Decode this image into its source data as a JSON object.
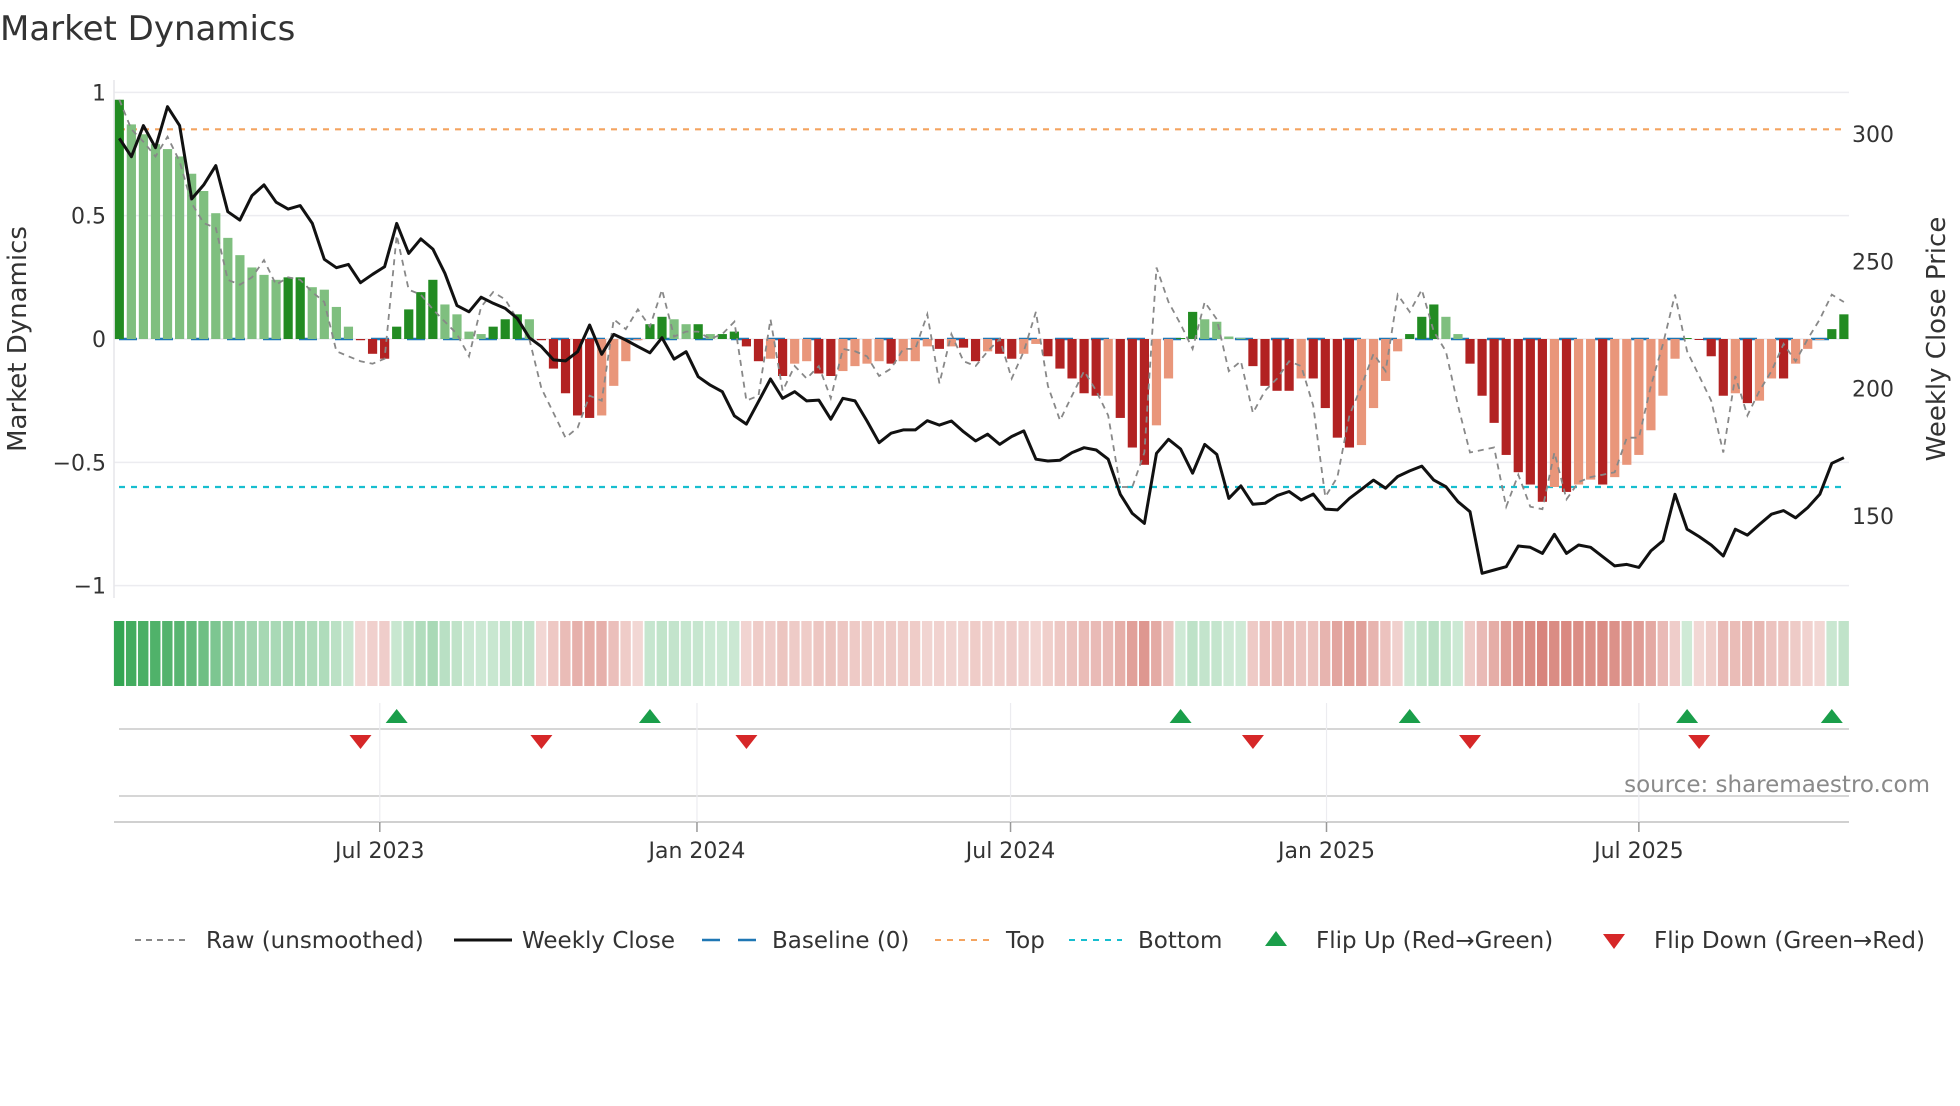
{
  "chart_data": {
    "type": "bar",
    "title": "Market Dynamics",
    "ylabel": "Market Dynamics",
    "ylabel_right": "Weekly Close Price",
    "xlabel": "",
    "ylim": [
      -1.05,
      1.05
    ],
    "ylim_right": [
      117.8,
      321.2
    ],
    "yticks": [
      {
        "v": 1,
        "label": "1"
      },
      {
        "v": 0.5,
        "label": "0.5"
      },
      {
        "v": 0,
        "label": "0"
      },
      {
        "v": -0.5,
        "label": "−0.5"
      },
      {
        "v": -1,
        "label": "−1"
      }
    ],
    "yticks_right": [
      {
        "v": 300,
        "label": "300"
      },
      {
        "v": 250,
        "label": "250"
      },
      {
        "v": 200,
        "label": "200"
      },
      {
        "v": 150,
        "label": "150"
      }
    ],
    "x_unit": "week index",
    "xticks": [
      {
        "week": 21.6,
        "label": "Jul 2023"
      },
      {
        "week": 47.9,
        "label": "Jan 2024"
      },
      {
        "week": 73.9,
        "label": "Jul 2024"
      },
      {
        "week": 100.1,
        "label": "Jan 2025"
      },
      {
        "week": 126.0,
        "label": "Jul 2025"
      }
    ],
    "grid": true,
    "legend_position": "bottom",
    "top_level": 0.85,
    "bottom_level": -0.6,
    "baseline": 0,
    "values": [
      0.97,
      0.87,
      0.83,
      0.79,
      0.77,
      0.74,
      0.67,
      0.6,
      0.51,
      0.41,
      0.34,
      0.29,
      0.26,
      0.24,
      0.25,
      0.25,
      0.21,
      0.2,
      0.13,
      0.05,
      -0.005,
      -0.06,
      -0.08,
      0.05,
      0.12,
      0.19,
      0.24,
      0.14,
      0.1,
      0.03,
      0.02,
      0.05,
      0.08,
      0.1,
      0.08,
      -0.005,
      -0.12,
      -0.22,
      -0.31,
      -0.32,
      -0.31,
      -0.19,
      -0.09,
      -0.005,
      0.06,
      0.09,
      0.08,
      0.06,
      0.06,
      0.02,
      0.02,
      0.03,
      -0.03,
      -0.09,
      -0.08,
      -0.15,
      -0.1,
      -0.09,
      -0.14,
      -0.15,
      -0.13,
      -0.11,
      -0.1,
      -0.09,
      -0.1,
      -0.09,
      -0.09,
      -0.03,
      -0.04,
      -0.03,
      -0.035,
      -0.09,
      -0.05,
      -0.06,
      -0.08,
      -0.06,
      -0.02,
      -0.07,
      -0.12,
      -0.16,
      -0.22,
      -0.23,
      -0.23,
      -0.32,
      -0.44,
      -0.51,
      -0.35,
      -0.16,
      0.004,
      0.11,
      0.08,
      0.07,
      0.01,
      0.004,
      -0.11,
      -0.19,
      -0.21,
      -0.21,
      -0.16,
      -0.16,
      -0.28,
      -0.4,
      -0.44,
      -0.43,
      -0.28,
      -0.17,
      -0.05,
      0.02,
      0.09,
      0.14,
      0.09,
      0.02,
      -0.1,
      -0.23,
      -0.34,
      -0.47,
      -0.54,
      -0.59,
      -0.66,
      -0.6,
      -0.62,
      -0.59,
      -0.57,
      -0.59,
      -0.56,
      -0.51,
      -0.47,
      -0.37,
      -0.23,
      -0.08,
      0.004,
      -0.004,
      -0.07,
      -0.23,
      -0.22,
      -0.26,
      -0.25,
      -0.16,
      -0.16,
      -0.1,
      -0.04,
      -0.004,
      0.04,
      0.1
    ],
    "shades": "dlllllllllllllddlllldddddddlllldddldddddllllddlldlddddldlldd lllldllldlddlddllddd ddldddlldd llllddddld dddllllddd lldddddddl dlldllllll ddddldlldl lldd",
    "raw": [
      0.97,
      0.85,
      0.8,
      0.74,
      0.82,
      0.72,
      0.55,
      0.47,
      0.45,
      0.24,
      0.22,
      0.25,
      0.32,
      0.22,
      0.25,
      0.24,
      0.19,
      0.15,
      -0.05,
      -0.07,
      -0.09,
      -0.1,
      -0.08,
      0.42,
      0.2,
      0.18,
      0.12,
      0.07,
      0.02,
      -0.07,
      0.13,
      0.19,
      0.16,
      0.08,
      0.0,
      -0.2,
      -0.3,
      -0.4,
      -0.36,
      -0.23,
      -0.25,
      0.08,
      0.04,
      0.12,
      0.05,
      0.2,
      0.01,
      0.03,
      0.03,
      0.0,
      0.02,
      0.07,
      -0.25,
      -0.23,
      0.08,
      -0.21,
      -0.11,
      -0.16,
      -0.11,
      -0.24,
      -0.04,
      -0.05,
      -0.07,
      -0.15,
      -0.12,
      -0.04,
      -0.04,
      0.1,
      -0.18,
      0.02,
      -0.09,
      -0.11,
      -0.05,
      0.0,
      -0.16,
      -0.05,
      0.11,
      -0.19,
      -0.33,
      -0.23,
      -0.13,
      -0.21,
      -0.31,
      -0.6,
      -0.6,
      -0.46,
      0.29,
      0.15,
      0.06,
      -0.04,
      0.15,
      0.08,
      -0.13,
      -0.09,
      -0.3,
      -0.21,
      -0.16,
      -0.09,
      -0.11,
      -0.27,
      -0.64,
      -0.56,
      -0.31,
      -0.19,
      -0.06,
      -0.13,
      0.18,
      0.11,
      0.2,
      0.03,
      -0.05,
      -0.27,
      -0.46,
      -0.45,
      -0.44,
      -0.68,
      -0.55,
      -0.68,
      -0.69,
      -0.46,
      -0.65,
      -0.58,
      -0.56,
      -0.55,
      -0.54,
      -0.4,
      -0.4,
      -0.19,
      -0.02,
      0.18,
      -0.05,
      -0.15,
      -0.25,
      -0.46,
      -0.15,
      -0.31,
      -0.21,
      -0.13,
      -0.02,
      -0.09,
      0.0,
      0.08,
      0.18,
      0.15
    ],
    "weekly_close": [
      298.3,
      291.1,
      303.3,
      294.6,
      310.7,
      303.3,
      274.5,
      280.0,
      287.6,
      269.5,
      266.2,
      275.8,
      280.0,
      273.2,
      270.5,
      271.9,
      264.9,
      250.8,
      247.5,
      248.8,
      241.6,
      244.9,
      247.9,
      264.9,
      253.1,
      258.8,
      254.8,
      245.3,
      232.6,
      230.2,
      235.9,
      233.5,
      231.5,
      227.6,
      220.0,
      216.5,
      211.3,
      210.9,
      214.5,
      225.0,
      213.5,
      221.3,
      219.1,
      216.5,
      214.1,
      220.0,
      211.6,
      214.5,
      204.7,
      201.4,
      198.8,
      189.3,
      186.1,
      194.9,
      203.8,
      196.2,
      198.8,
      195.2,
      195.5,
      188.0,
      196.2,
      195.2,
      187.3,
      178.8,
      182.5,
      183.8,
      183.8,
      187.4,
      185.7,
      187.3,
      183.1,
      179.5,
      182.1,
      178.1,
      181.2,
      183.4,
      172.3,
      171.6,
      171.9,
      174.9,
      176.8,
      175.9,
      172.3,
      158.5,
      151.0,
      147.1,
      174.6,
      180.1,
      176.3,
      166.8,
      178.1,
      174.2,
      156.9,
      161.8,
      154.6,
      155.0,
      158.0,
      159.6,
      156.3,
      158.6,
      152.7,
      152.4,
      156.9,
      160.5,
      164.1,
      160.9,
      165.5,
      167.7,
      169.6,
      164.1,
      161.5,
      155.6,
      151.7,
      127.5,
      128.8,
      130.1,
      138.2,
      137.7,
      135.3,
      142.8,
      135.3,
      138.6,
      137.7,
      134.0,
      130.4,
      131.0,
      129.8,
      136.3,
      140.3,
      158.5,
      144.8,
      141.9,
      138.6,
      134.3,
      144.8,
      142.5,
      146.7,
      150.7,
      152.1,
      149.3,
      153.3,
      158.5,
      170.7,
      172.9
    ],
    "flip_up_weeks": [
      23,
      44,
      88,
      107,
      130,
      142
    ],
    "flip_down_weeks": [
      20,
      35,
      52,
      94,
      112,
      131
    ],
    "legend": [
      {
        "key": "raw",
        "label": "Raw (unsmoothed)"
      },
      {
        "key": "close",
        "label": "Weekly Close"
      },
      {
        "key": "baseline",
        "label": "Baseline (0)"
      },
      {
        "key": "top",
        "label": "Top"
      },
      {
        "key": "bottom",
        "label": "Bottom"
      },
      {
        "key": "flip_up",
        "label": "Flip Up (Red→Green)"
      },
      {
        "key": "flip_down",
        "label": "Flip Down (Green→Red)"
      }
    ],
    "source": "source: sharemaestro.com"
  },
  "colors": {
    "pos_strong": "#228b22",
    "pos_weak": "#7fbf7f",
    "neg_strong": "#b22222",
    "neg_weak": "#e9967a",
    "raw": "#888888",
    "close": "#111111",
    "baseline": "#1f77b4",
    "top": "#f4a460",
    "bottom": "#17becf",
    "flip_up": "#1a9e4a",
    "flip_down": "#d62728"
  }
}
